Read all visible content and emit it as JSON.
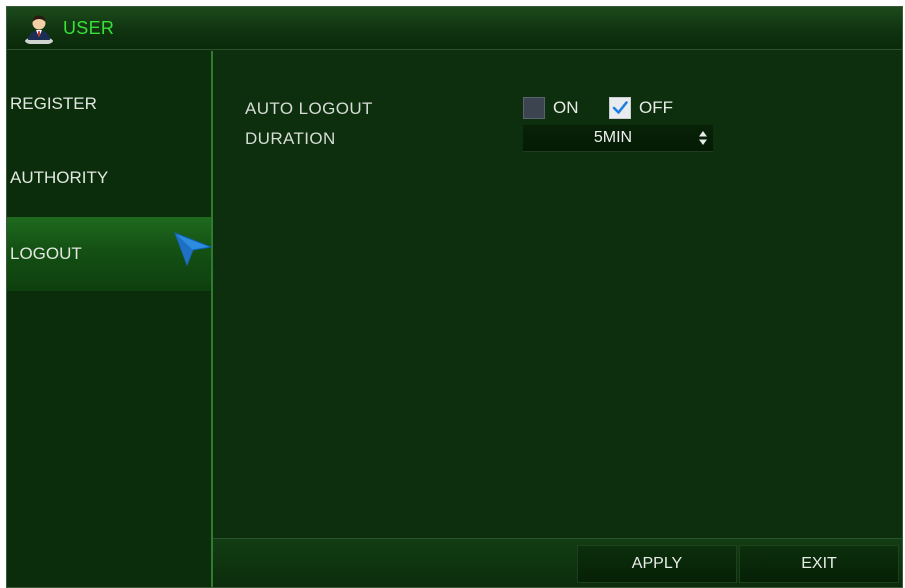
{
  "window": {
    "title": "USER",
    "title_icon": "user-icon",
    "accent_color": "#38e038"
  },
  "sidebar": {
    "items": [
      {
        "label": "REGISTER",
        "active": false
      },
      {
        "label": "AUTHORITY",
        "active": false
      },
      {
        "label": "LOGOUT",
        "active": true
      }
    ]
  },
  "settings": {
    "auto_logout": {
      "label": "AUTO LOGOUT",
      "options": [
        {
          "label": "ON",
          "checked": false
        },
        {
          "label": "OFF",
          "checked": true
        }
      ]
    },
    "duration": {
      "label": "DURATION",
      "value": "5MIN"
    }
  },
  "footer": {
    "apply_label": "APPLY",
    "exit_label": "EXIT"
  }
}
